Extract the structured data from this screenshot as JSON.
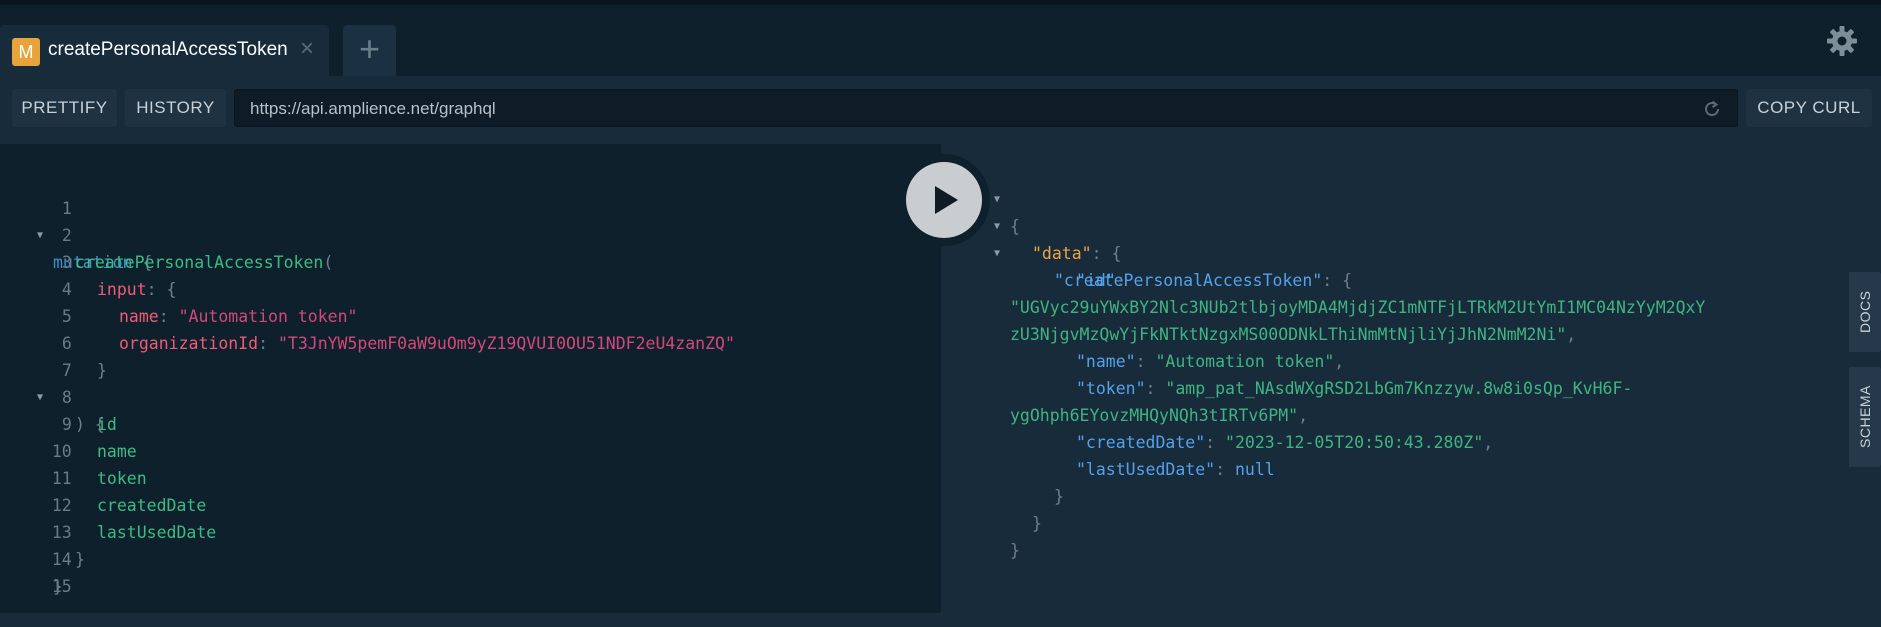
{
  "tabs": {
    "active": {
      "badge": "M",
      "label": "createPersonalAccessToken",
      "close": "×"
    },
    "add_label": "+"
  },
  "toolbar": {
    "prettify_label": "PRETTIFY",
    "history_label": "HISTORY",
    "copy_curl_label": "COPY CURL"
  },
  "endpoint": {
    "url": "https://api.amplience.net/graphql"
  },
  "editor": {
    "line_numbers": [
      "1",
      "2",
      "3",
      "4",
      "5",
      "6",
      "7",
      "8",
      "9",
      "10",
      "11",
      "12",
      "13",
      "14",
      "15"
    ],
    "lines": {
      "l1_kw": "mutation",
      "l1_p": " {",
      "l2_fn": "createPersonalAccessToken",
      "l2_p": "(",
      "l3_arg": "input",
      "l3_p": ": {",
      "l4_key": "name",
      "l4_p": ": ",
      "l4_val": "\"Automation token\"",
      "l5_key": "organizationId",
      "l5_p": ": ",
      "l5_val": "\"T3JnYW5pemF0aW9uOm9yZ19QVUI0OU51NDF2eU4zanZQ\"",
      "l6_p": "}",
      "l7_p": ") {",
      "l8_f": "id",
      "l9_f": "name",
      "l10_f": "token",
      "l11_f": "createdDate",
      "l12_f": "lastUsedDate",
      "l13_p": "}",
      "l14_p": "}"
    }
  },
  "result": {
    "open_brace": "{",
    "data_key": "\"data\"",
    "colon_brace": ": {",
    "cpat_key": "\"createPersonalAccessToken\"",
    "id_key": "\"id\"",
    "colon": ":",
    "colon_space": ": ",
    "comma": ",",
    "id_value_1": "\"UGVyc29uYWxBY2Nlc3NUb2tlbjoyMDA4MjdjZC1mNTFjLTRkM2UtYmI1MC04NzYyM2QxY",
    "id_value_2": "zU3NjgvMzQwYjFkNTktNzgxMS00ODNkLThiNmMtNjliYjJhN2NmM2Ni\"",
    "name_key": "\"name\"",
    "name_value": "\"Automation token\"",
    "token_key": "\"token\"",
    "token_value_1": "\"amp_pat_NAsdWXgRSD2LbGm7Knzzyw.8w8i0sQp_KvH6F-",
    "token_value_2": "ygOhph6EYovzMHQyNQh3tIRTv6PM\"",
    "created_key": "\"createdDate\"",
    "created_value": "\"2023-12-05T20:50:43.280Z\"",
    "lastused_key": "\"lastUsedDate\"",
    "lastused_value": "null",
    "close_brace": "}"
  },
  "side": {
    "docs_label": "DOCS",
    "schema_label": "SCHEMA"
  },
  "icons": {
    "settings": "gear-icon",
    "reload": "reload-icon",
    "play": "play-icon",
    "close": "close-icon",
    "fold": "fold-arrow-icon"
  },
  "colors": {
    "badge": "#e8a33a",
    "keyword": "#3f8fd0",
    "field": "#3dbb82",
    "argument": "#ef5b74",
    "string_arg": "#d4477a",
    "json_key": "#54a1ea",
    "json_string": "#3fb482",
    "data_key": "#f0a246"
  }
}
